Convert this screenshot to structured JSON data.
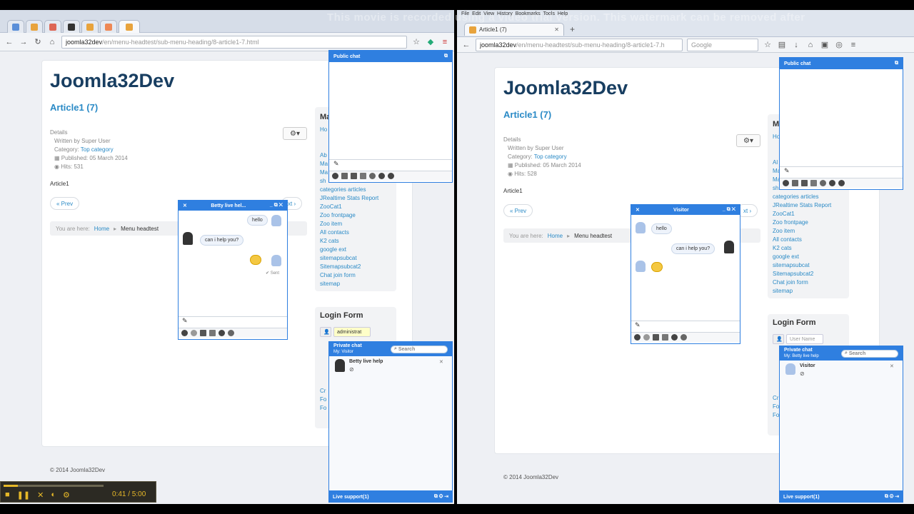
{
  "watermark": "This movie is recorded using a video trial version. This watermark can be removed after",
  "left": {
    "url_host": "joomla32dev",
    "url_path": "/en/menu-headtest/sub-menu-heading/8-article1-7.html",
    "brand": "Joomla32Dev",
    "article_title": "Article1 (7)",
    "details_label": "Details",
    "written_by": "Written by Super User",
    "category_label": "Category:",
    "category_value": "Top category",
    "published": "Published: 05 March 2014",
    "hits": "Hits: 531",
    "body": "Article1",
    "prev": "« Prev",
    "next_partial": "xt ›",
    "you_are_here": "You are here:",
    "crumb_home": "Home",
    "crumb_menu": "Menu headtest",
    "menu_heading_partial": "Ma",
    "menu_items": [
      "Ho",
      "Ab",
      "Ma",
      "Ma",
      "sh",
      "categories articles",
      "JRealtime Stats Report",
      "ZooCat1",
      "Zoo frontpage",
      "Zoo item",
      "All contacts",
      "K2 cats",
      "google ext",
      "sitemapsubcat",
      "Sitemapsubcat2",
      "Chat join form",
      "sitemap"
    ],
    "login_title": "Login Form",
    "login_user": "administrat",
    "login_bottom_partial": [
      "Cr",
      "Fo",
      "Fo"
    ],
    "footer": "© 2014 Joomla32Dev",
    "public_chat": "Public chat",
    "chat_name": "Betty live hel...",
    "msg_hello": "hello",
    "msg_help": "can i help you?",
    "sent": "✔ Sent",
    "private_chat": "Private chat",
    "private_sub": "My: Visitor",
    "search_placeholder": "Search",
    "contact_name": "Betty live help",
    "live_support": "Live support(1)"
  },
  "right": {
    "tab_title": "Article1 (7)",
    "url_host": "joomla32dev",
    "url_path": "/en/menu-headtest/sub-menu-heading/8-article1-7.h",
    "search_engine": "Google",
    "brand": "Joomla32Dev",
    "article_title": "Article1 (7)",
    "details_label": "Details",
    "written_by": "Written by Super User",
    "category_label": "Category:",
    "category_value": "Top category",
    "published": "Published: 05 March 2014",
    "hits": "Hits: 528",
    "body": "Article1",
    "prev": "« Prev",
    "next_partial": "xt ›",
    "you_are_here": "You are here:",
    "crumb_home": "Home",
    "crumb_menu": "Menu headtest",
    "menu_heading_partial": "M",
    "menu_items": [
      "Ho",
      "Al",
      "Ma",
      "Ma",
      "sh",
      "categories articles",
      "JRealtime Stats Report",
      "ZooCat1",
      "Zoo frontpage",
      "Zoo item",
      "All contacts",
      "K2 cats",
      "google ext",
      "sitemapsubcat",
      "Sitemapsubcat2",
      "Chat join form",
      "sitemap"
    ],
    "login_title": "Login Form",
    "login_user": "User Name",
    "login_bottom_partial": [
      "Cr",
      "Fo",
      "Fo"
    ],
    "footer": "© 2014 Joomla32Dev",
    "public_chat": "Public chat",
    "chat_name": "Visitor",
    "msg_hello": "hello",
    "msg_help": "can i help you?",
    "private_chat": "Private chat",
    "private_sub": "My: Betty live help",
    "search_placeholder": "Search",
    "contact_name": "Visitor",
    "live_support": "Live support(1)"
  },
  "player": {
    "time": "0:41 / 5:00"
  }
}
